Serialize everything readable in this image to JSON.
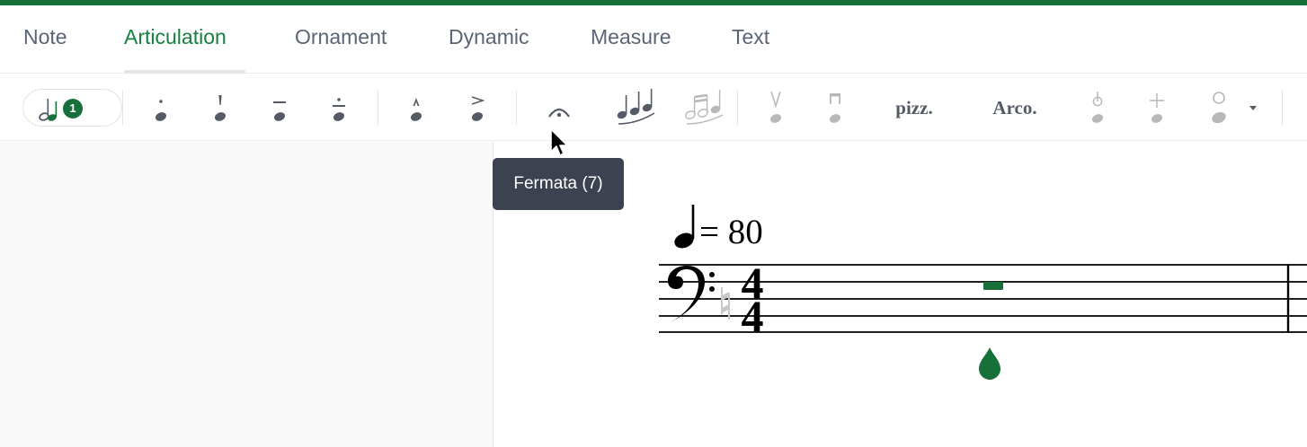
{
  "tabs": [
    {
      "label": "Note",
      "active": false
    },
    {
      "label": "Articulation",
      "active": true
    },
    {
      "label": "Ornament",
      "active": false
    },
    {
      "label": "Dynamic",
      "active": false
    },
    {
      "label": "Measure",
      "active": false
    },
    {
      "label": "Text",
      "active": false
    }
  ],
  "toolbar": {
    "note_badge": "1",
    "pizz_label": "pizz.",
    "arco_label": "Arco."
  },
  "tooltip": {
    "text": "Fermata (7)"
  },
  "score": {
    "tempo_value": "= 80",
    "time_signature": {
      "top": "4",
      "bottom": "4"
    }
  },
  "colors": {
    "accent": "#17803f",
    "tab_text": "#5b6475",
    "icon": "#555b66",
    "icon_disabled": "#b8b8b8",
    "tooltip_bg": "#3c4250",
    "score_note": "#17703a"
  }
}
